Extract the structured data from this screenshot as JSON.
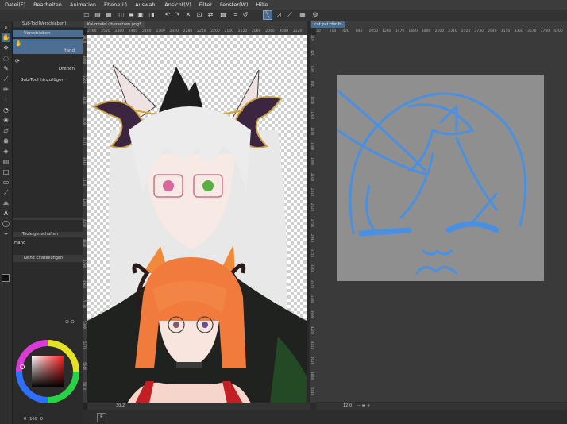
{
  "menu": [
    "Datei(F)",
    "Bearbeiten",
    "Animation",
    "Ebene(L)",
    "Auswahl",
    "Ansicht(V)",
    "Filter",
    "Fenster(W)",
    "Hilfe"
  ],
  "subtool": {
    "header": "Sub-Tool[Verschieben]",
    "items": [
      {
        "label": "Verschieben"
      },
      {
        "label": "Hand"
      },
      {
        "label": "Drehen"
      }
    ],
    "add_label": "Sub-Tool hinzufügen"
  },
  "tool_properties": {
    "header": "Tooleigenschaften",
    "tool_name": "Hand",
    "empty_label": "Keine Einstellungen"
  },
  "canvas1": {
    "tab": "Koi model übersetzen.png*",
    "ruler": [
      "2560",
      "2520",
      "2480",
      "2440",
      "2400",
      "2360",
      "2320",
      "2280",
      "2240",
      "2200",
      "2160",
      "2120",
      "2080",
      "2040",
      "3080",
      "3120"
    ],
    "zoom": "30.2",
    "vruler": [
      "2920",
      "3090",
      "3260",
      "3430",
      "3600",
      "3770",
      "3940",
      "4110",
      "4280",
      "4450",
      "4620",
      "4790",
      "4960",
      "5130",
      "5300",
      "5470",
      "5640",
      "5810"
    ]
  },
  "canvas2": {
    "tab": "cat pat rfer fo",
    "ruler": [
      "30",
      "210",
      "420",
      "840",
      "1050",
      "1260",
      "1470",
      "1680",
      "1890",
      "2100",
      "2310",
      "2520",
      "2730",
      "2940",
      "3150",
      "3360",
      "3570",
      "3780",
      "4200"
    ],
    "zoom": "12.0",
    "vruler": [
      "210",
      "420",
      "630",
      "840",
      "1050",
      "1260",
      "1470",
      "1680",
      "1890",
      "2100",
      "2310",
      "2520",
      "2730",
      "2940",
      "3150",
      "3360",
      "3570",
      "3780",
      "3990",
      "4200",
      "4410",
      "4620",
      "4830",
      "5040"
    ]
  },
  "colors": {
    "accent": "#4c6e92",
    "sketch_blue": "#4a90e2",
    "canvas_gray": "#8f8f8f"
  },
  "color_panel": {
    "values": [
      "0",
      "100",
      "0"
    ]
  }
}
